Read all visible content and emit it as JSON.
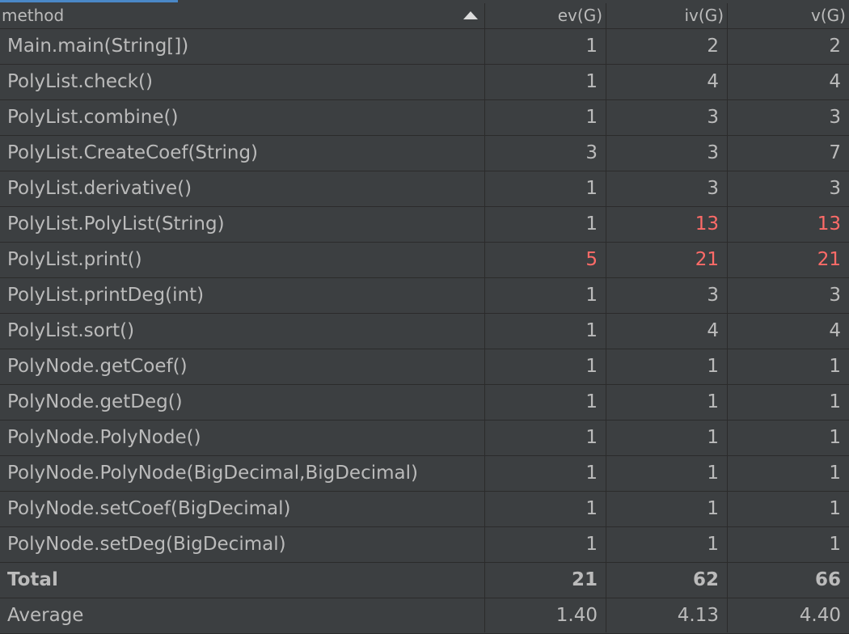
{
  "columns": {
    "method": "method",
    "ev": "ev(G)",
    "iv": "iv(G)",
    "v": "v(G)"
  },
  "sort": {
    "column": "method",
    "direction": "ascending"
  },
  "highlight_color": "#ff6b68",
  "rows": [
    {
      "method": "Main.main(String[])",
      "ev": "1",
      "iv": "2",
      "v": "2"
    },
    {
      "method": "PolyList.check()",
      "ev": "1",
      "iv": "4",
      "v": "4"
    },
    {
      "method": "PolyList.combine()",
      "ev": "1",
      "iv": "3",
      "v": "3"
    },
    {
      "method": "PolyList.CreateCoef(String)",
      "ev": "3",
      "iv": "3",
      "v": "7"
    },
    {
      "method": "PolyList.derivative()",
      "ev": "1",
      "iv": "3",
      "v": "3"
    },
    {
      "method": "PolyList.PolyList(String)",
      "ev": "1",
      "iv": "13",
      "v": "13"
    },
    {
      "method": "PolyList.print()",
      "ev": "5",
      "iv": "21",
      "v": "21"
    },
    {
      "method": "PolyList.printDeg(int)",
      "ev": "1",
      "iv": "3",
      "v": "3"
    },
    {
      "method": "PolyList.sort()",
      "ev": "1",
      "iv": "4",
      "v": "4"
    },
    {
      "method": "PolyNode.getCoef()",
      "ev": "1",
      "iv": "1",
      "v": "1"
    },
    {
      "method": "PolyNode.getDeg()",
      "ev": "1",
      "iv": "1",
      "v": "1"
    },
    {
      "method": "PolyNode.PolyNode()",
      "ev": "1",
      "iv": "1",
      "v": "1"
    },
    {
      "method": "PolyNode.PolyNode(BigDecimal,BigDecimal)",
      "ev": "1",
      "iv": "1",
      "v": "1"
    },
    {
      "method": "PolyNode.setCoef(BigDecimal)",
      "ev": "1",
      "iv": "1",
      "v": "1"
    },
    {
      "method": "PolyNode.setDeg(BigDecimal)",
      "ev": "1",
      "iv": "1",
      "v": "1"
    }
  ],
  "total": {
    "label": "Total",
    "ev": "21",
    "iv": "62",
    "v": "66"
  },
  "average": {
    "label": "Average",
    "ev": "1.40",
    "iv": "4.13",
    "v": "4.40"
  }
}
